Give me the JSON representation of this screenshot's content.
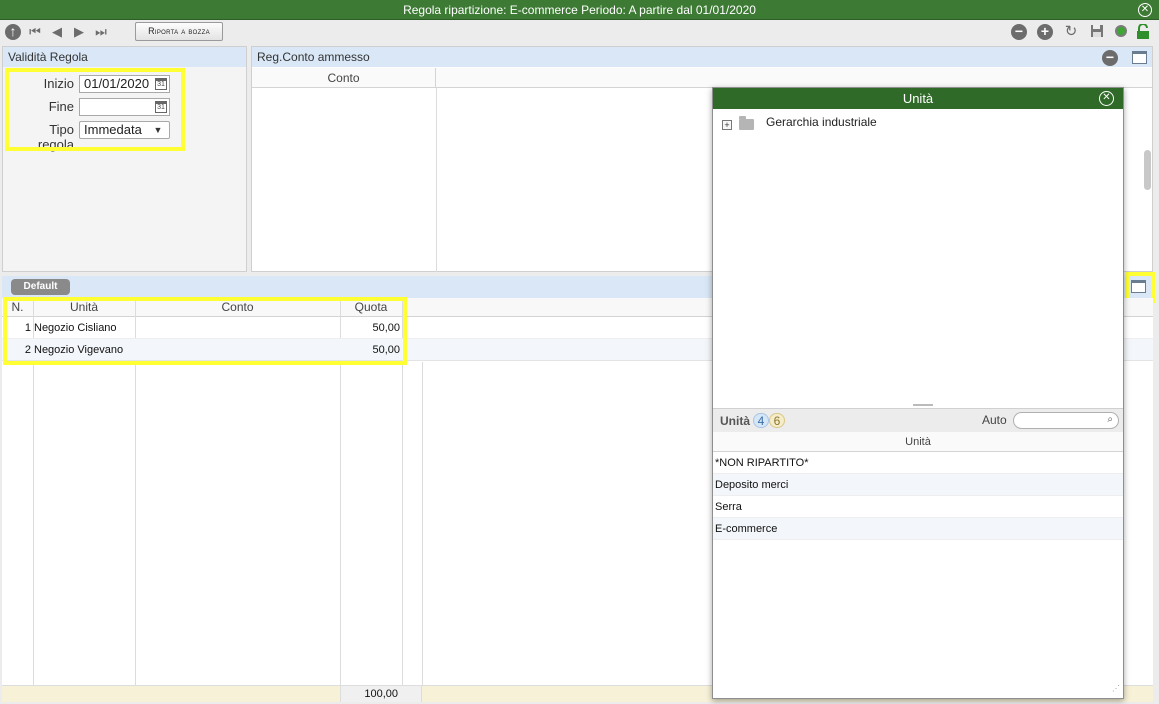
{
  "window": {
    "title": "Regola ripartizione: E-commerce Periodo: A partire dal 01/01/2020"
  },
  "toolbar": {
    "back_label": "Riporta a bozza"
  },
  "validity": {
    "title": "Validità Regola",
    "inizio_label": "Inizio",
    "inizio_value": "01/01/2020",
    "fine_label": "Fine",
    "fine_value": "",
    "tipo_label": "Tipo regola",
    "tipo_value": "Immedata"
  },
  "conto_panel": {
    "title": "Reg.Conto ammesso",
    "col_conto": "Conto"
  },
  "bottom": {
    "tab": "Default",
    "columns": [
      "N.",
      "Unità",
      "Conto",
      "Quota"
    ],
    "rows": [
      {
        "n": "1",
        "unita": "Negozio Cisliano",
        "conto": "",
        "quota": "50,00"
      },
      {
        "n": "2",
        "unita": "Negozio Vigevano",
        "conto": "",
        "quota": "50,00"
      }
    ],
    "total": "100,00"
  },
  "unit_popup": {
    "title": "Unità",
    "tree_root": "Gerarchia industriale",
    "list_label": "Unità",
    "badge_a": "4",
    "badge_b": "6",
    "auto_label": "Auto",
    "column": "Unità",
    "items": [
      "*NON RIPARTITO*",
      "Deposito merci",
      "Serra",
      "E-commerce"
    ]
  },
  "colors": {
    "titlebar": "#3d7a34",
    "header_blue": "#d9e7f6",
    "highlight": "#ffff33"
  }
}
